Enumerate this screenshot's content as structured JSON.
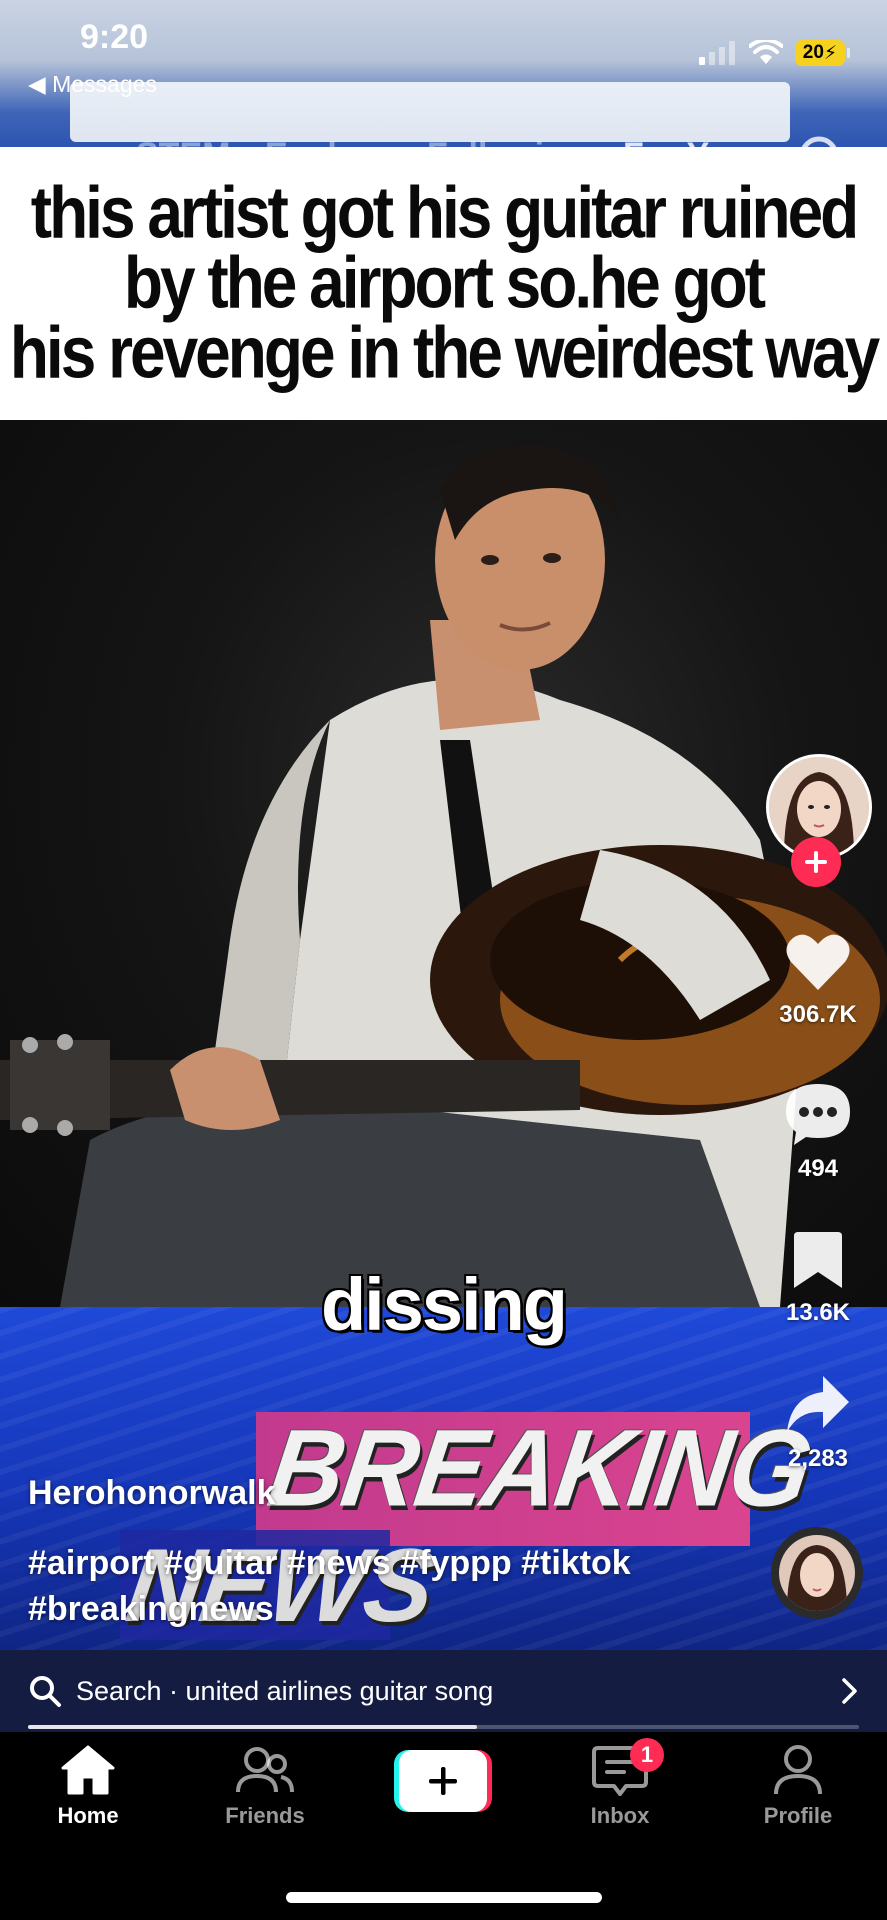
{
  "status_bar": {
    "time": "9:20",
    "back_app": "Messages",
    "battery": "20"
  },
  "top_tabs": [
    {
      "label": "STEM",
      "active": false
    },
    {
      "label": "Explore",
      "active": false
    },
    {
      "label": "Following",
      "active": false
    },
    {
      "label": "For You",
      "active": true
    }
  ],
  "video": {
    "caption_lines": [
      "this artist got his guitar ruined",
      "by the airport so.he got",
      "his revenge in the weirdest way"
    ],
    "overlay_word": "dissing",
    "banner_line1": "BREAKING",
    "banner_line2": "NEWS"
  },
  "actions": {
    "likes": "306.7K",
    "comments": "494",
    "saves": "13.6K",
    "shares": "2,283"
  },
  "post": {
    "username": "Herohonorwalk",
    "hashtags_line1": "#airport #guitar #news #fyppp #tiktok",
    "hashtags_line2": "#breakingnews"
  },
  "search_suggestion": {
    "text": "Search · united airlines guitar song"
  },
  "playback_progress": 0.54,
  "bottom_nav": {
    "home": "Home",
    "friends": "Friends",
    "inbox": "Inbox",
    "inbox_badge": "1",
    "profile": "Profile"
  },
  "colors": {
    "accent_red": "#fe2c55",
    "accent_cyan": "#25f4ee",
    "battery_yellow": "#f6d21f"
  }
}
